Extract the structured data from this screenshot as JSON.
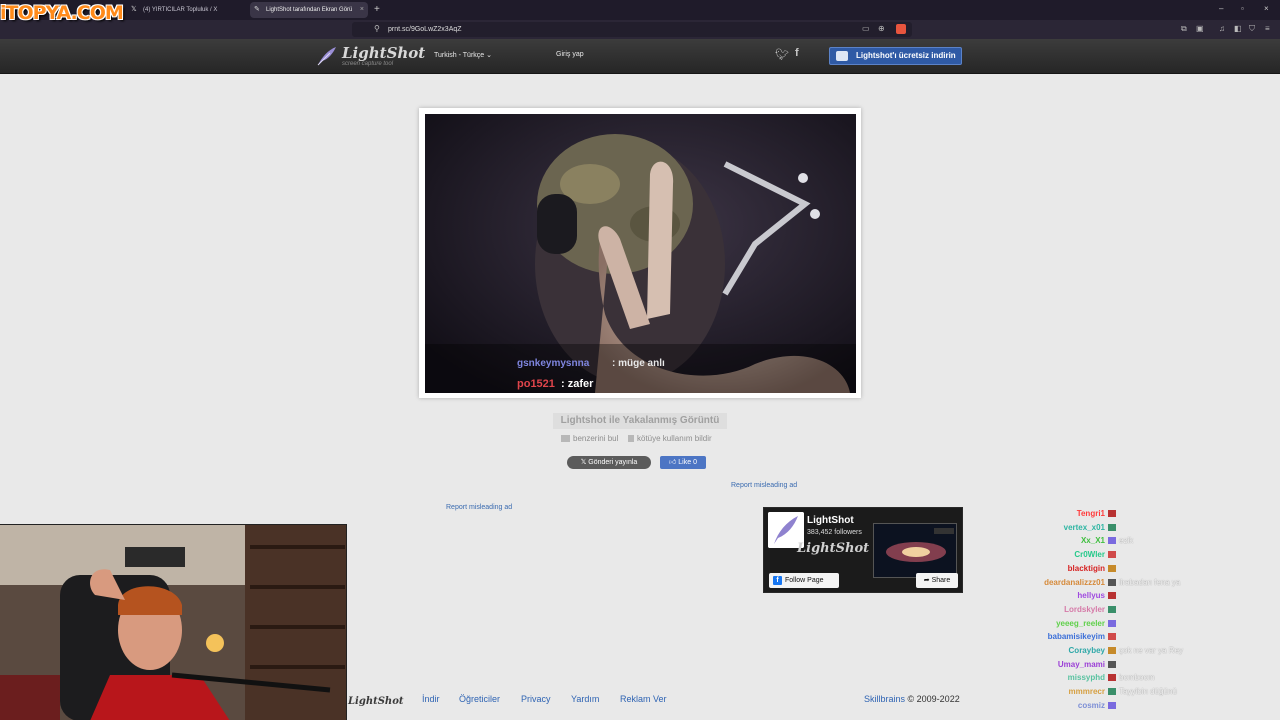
{
  "browser": {
    "tabs": [
      {
        "title": "(4) YIRTICILAR Topluluk / X",
        "icon": "x-logo-icon",
        "active": false
      },
      {
        "title": "LightShot tarafından Ekran Görü",
        "icon": "lightshot-icon",
        "active": true
      }
    ],
    "new_tab": "+",
    "url": "prnt.sc/9GoLwZ2x3AqZ",
    "window_controls": [
      "–",
      "▫",
      "×"
    ]
  },
  "header": {
    "logo_text": "LightShot",
    "logo_sub": "screen capture tool",
    "language": "Turkish - Türkçe",
    "login": "Giriş yap",
    "download_button": "Lightshot'ı ücretsiz indirin",
    "social": [
      "twitter-icon",
      "facebook-icon"
    ]
  },
  "screenshot": {
    "subtitle_line1_user": "gsnkeymysnna",
    "subtitle_line1_text": ": müge anlı",
    "subtitle_line2_user": "po1521",
    "subtitle_line2_text": ": zafer"
  },
  "caption": "Lightshot ile Yakalanmış Görüntü",
  "actions": {
    "find_similar": "benzerini bul",
    "report_abuse": "kötüye kullanım bildir",
    "tweet": "Gönderi yayınla",
    "like": "Like 0",
    "report_ad_1": "Report misleading ad",
    "report_ad_2": "Report misleading ad"
  },
  "fb_widget": {
    "name": "LightShot",
    "followers": "383,452 followers",
    "logo": "LightShot",
    "follow": "Follow Page",
    "share": "Share"
  },
  "footer": {
    "logo": "LightShot",
    "links": [
      "İndir",
      "Öğreticiler",
      "Privacy",
      "Yardım",
      "Reklam Ver"
    ],
    "brand": "Skillbrains",
    "copyright": "© 2009-2022"
  },
  "overlay": {
    "watermark": "iTOPYA.COM",
    "chat": [
      {
        "user": "Tengri1",
        "color": "#ff3b3b",
        "msg": ""
      },
      {
        "user": "vertex_x01",
        "color": "#2fb6a3",
        "msg": ""
      },
      {
        "user": "Xx_X1",
        "color": "#3fbf3f",
        "msg": "ezik"
      },
      {
        "user": "Cr0Wler",
        "color": "#25c98a",
        "msg": ""
      },
      {
        "user": "blacktigin",
        "color": "#d62222",
        "msg": ""
      },
      {
        "user": "deardanalizzz01",
        "color": "#d68a3a",
        "msg": "lirabadan fena ya"
      },
      {
        "user": "hellyus",
        "color": "#a04be0",
        "msg": ""
      },
      {
        "user": "Lordskyler",
        "color": "#d67aa8",
        "msg": ""
      },
      {
        "user": "yeeeg_reeler",
        "color": "#5fd04a",
        "msg": ""
      },
      {
        "user": "babamisikeyim",
        "color": "#3b6fd8",
        "msg": ""
      },
      {
        "user": "Coraybey",
        "color": "#2ea8a8",
        "msg": "çok ne var ya Rey"
      },
      {
        "user": "Umay_mami",
        "color": "#9b3fd6",
        "msg": ""
      },
      {
        "user": "missyphd",
        "color": "#58c2a0",
        "msg": "bomboom"
      },
      {
        "user": "mmmrecr",
        "color": "#d6a042",
        "msg": "Tayyibin düğünü"
      },
      {
        "user": "cosmiz",
        "color": "#7d8fd6",
        "msg": ""
      }
    ]
  }
}
